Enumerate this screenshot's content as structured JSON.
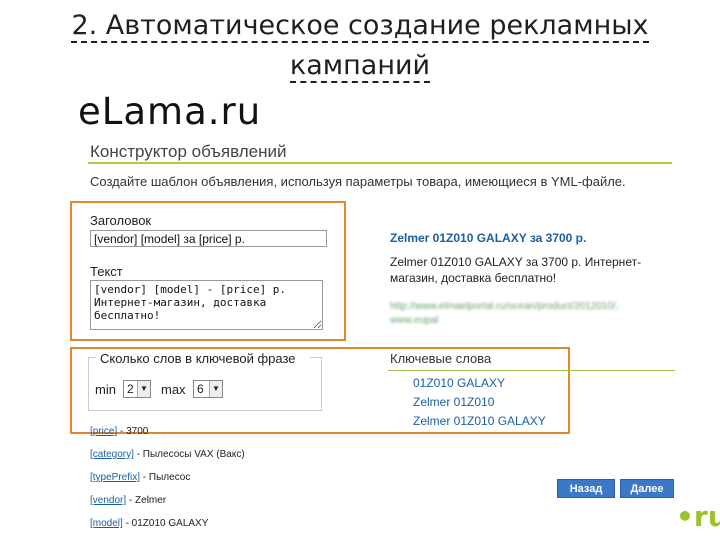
{
  "slide": {
    "title_line1": "2. Автоматическое создание рекламных",
    "title_line2": "кампаний",
    "brand": "eLama.ru"
  },
  "constructor": {
    "title": "Конструктор объявлений",
    "instruction": "Создайте шаблон объявления, используя параметры товара, имеющиеся в YML-файле.",
    "heading_label": "Заголовок",
    "heading_value": "[vendor] [model] за [price] р.",
    "text_label": "Текст",
    "text_value": "[vendor] [model] - [price] р. Интернет-магазин, доставка бесплатно!"
  },
  "preview": {
    "title": "Zelmer 01Z010 GALAXY за 3700 р.",
    "text": "Zelmer 01Z010 GALAXY за 3700 р. Интернет-магазин, доставка бесплатно!",
    "url_line1": "http://www.elmaelportal.ru/ocean/product/2012010/,",
    "url_line2": "www.eupal"
  },
  "word_count": {
    "legend": "Сколько слов в ключевой фразе",
    "min_label": "min",
    "min_value": "2",
    "max_label": "max",
    "max_value": "6"
  },
  "keywords": {
    "header": "Ключевые слова",
    "items": [
      "01Z010 GALAXY",
      "Zelmer 01Z010",
      "Zelmer 01Z010 GALAXY"
    ]
  },
  "params": [
    {
      "key": "[price]",
      "value": " - 3700"
    },
    {
      "key": "[category]",
      "value": " - Пылесосы VAX (Вакс)"
    },
    {
      "key": "[typePrefix]",
      "value": " - Пылесос"
    },
    {
      "key": "[vendor]",
      "value": " - Zelmer"
    },
    {
      "key": "[model]",
      "value": " - 01Z010 GALAXY"
    }
  ],
  "buttons": {
    "back": "Назад",
    "next": "Далее"
  },
  "logo": {
    "text": "•ru"
  },
  "colors": {
    "accent_orange": "#e0892e",
    "link_blue": "#1a5fa3",
    "rule_green": "#b7c94a",
    "button_blue": "#3b78c8",
    "logo_green": "#9cc22d"
  }
}
